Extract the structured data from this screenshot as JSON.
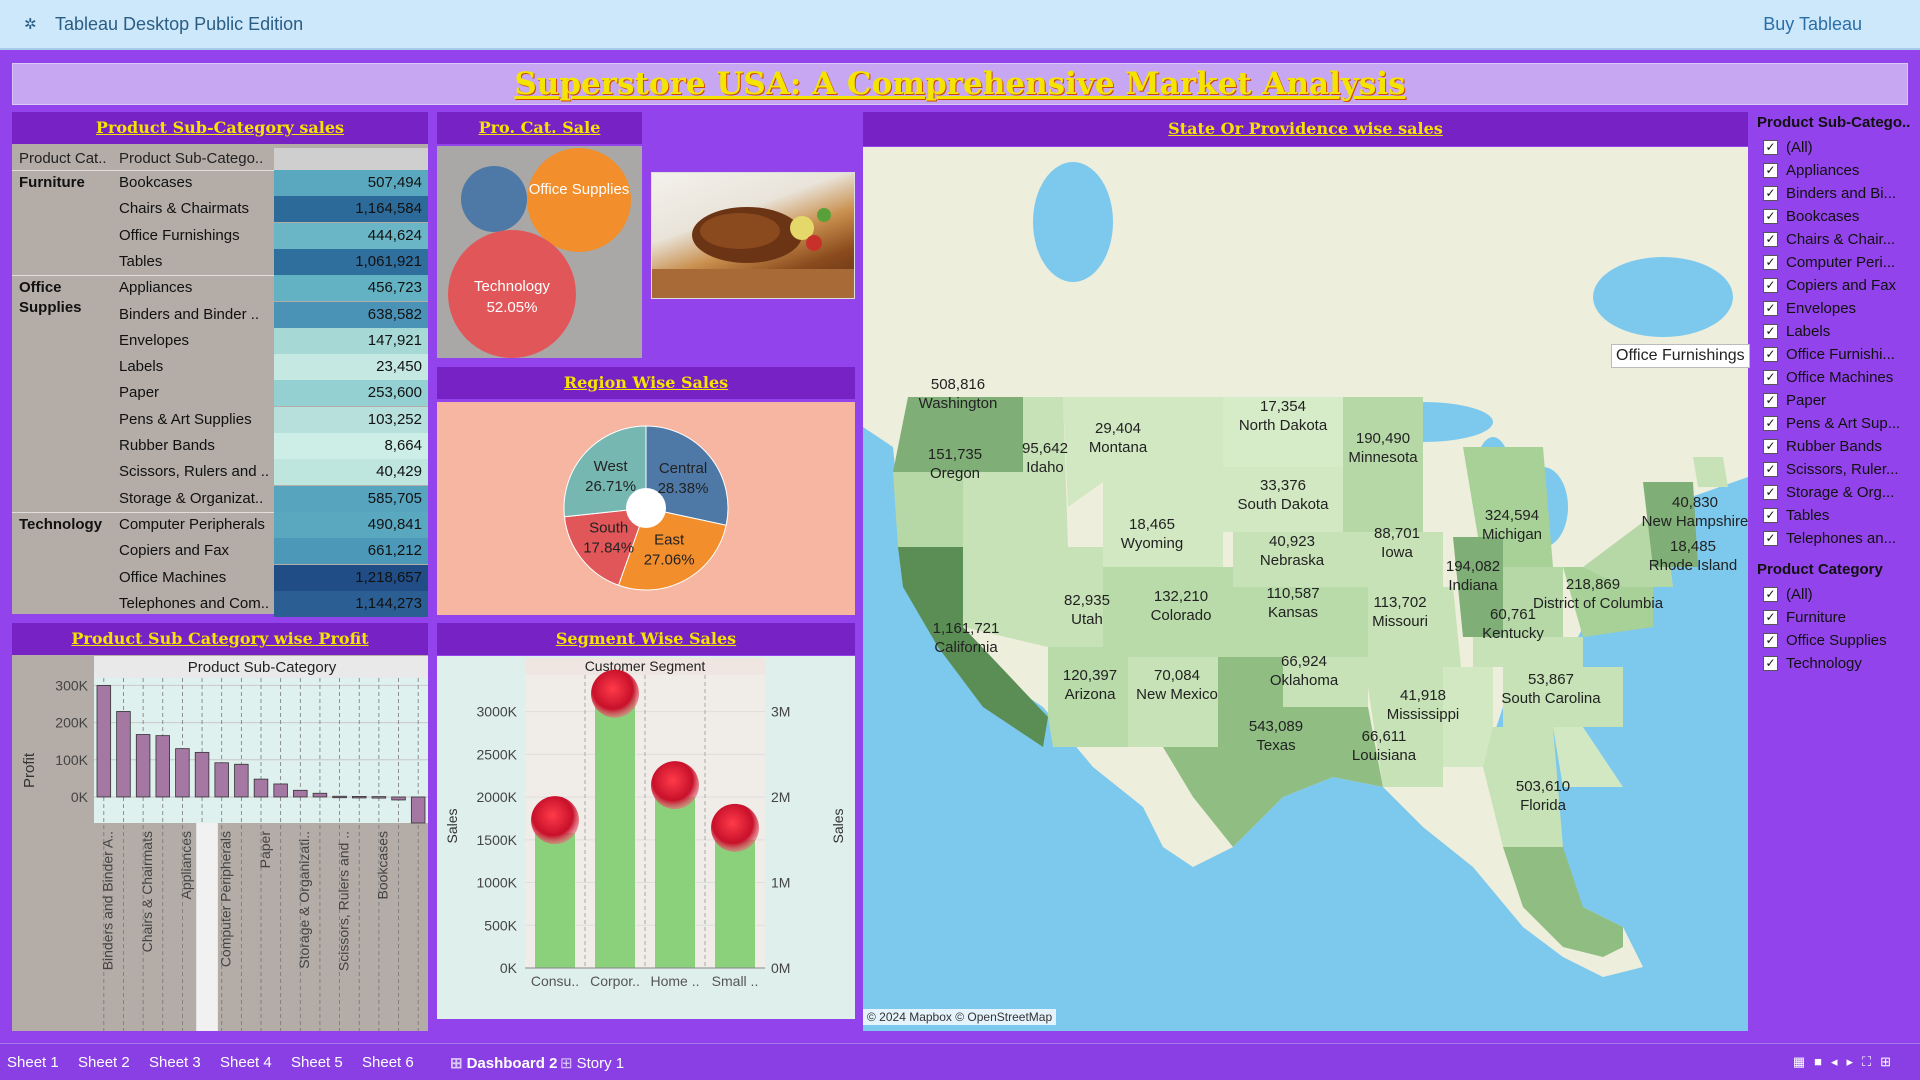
{
  "header": {
    "app_title": "Tableau Desktop Public Edition",
    "buy_label": "Buy Tableau"
  },
  "dashboard_title": "Superstore USA: A Comprehensive Market Analysis",
  "subcat_sales": {
    "title": "Product Sub-Category sales",
    "col1": "Product Cat..",
    "col2": "Product Sub-Catego..",
    "rows": [
      {
        "cat": "Furniture",
        "sub": "Bookcases",
        "val": "507,494"
      },
      {
        "cat": "",
        "sub": "Chairs & Chairmats",
        "val": "1,164,584"
      },
      {
        "cat": "",
        "sub": "Office Furnishings",
        "val": "444,624"
      },
      {
        "cat": "",
        "sub": "Tables",
        "val": "1,061,921"
      },
      {
        "cat": "Office Supplies",
        "sub": "Appliances",
        "val": "456,723"
      },
      {
        "cat": "",
        "sub": "Binders and Binder ..",
        "val": "638,582"
      },
      {
        "cat": "",
        "sub": "Envelopes",
        "val": "147,921"
      },
      {
        "cat": "",
        "sub": "Labels",
        "val": "23,450"
      },
      {
        "cat": "",
        "sub": "Paper",
        "val": "253,600"
      },
      {
        "cat": "",
        "sub": "Pens & Art Supplies",
        "val": "103,252"
      },
      {
        "cat": "",
        "sub": "Rubber Bands",
        "val": "8,664"
      },
      {
        "cat": "",
        "sub": "Scissors, Rulers and ..",
        "val": "40,429"
      },
      {
        "cat": "",
        "sub": "Storage & Organizat..",
        "val": "585,705"
      },
      {
        "cat": "Technology",
        "sub": "Computer Peripherals",
        "val": "490,841"
      },
      {
        "cat": "",
        "sub": "Copiers and Fax",
        "val": "661,212"
      },
      {
        "cat": "",
        "sub": "Office Machines",
        "val": "1,218,657"
      },
      {
        "cat": "",
        "sub": "Telephones and Com..",
        "val": "1,144,273"
      }
    ]
  },
  "cat_sale": {
    "title": "Pro. Cat. Sale",
    "bubbles": [
      {
        "label": "",
        "pct": "",
        "color": "#4e79a7"
      },
      {
        "label": "Office Supplies",
        "pct": "",
        "color": "#f28e2b"
      },
      {
        "label": "Technology",
        "pct": "52.05%",
        "color": "#e15759"
      }
    ]
  },
  "region_sales": {
    "title": "Region Wise Sales",
    "slices": [
      {
        "name": "Central",
        "pct": "28.38%",
        "value": 28.38,
        "color": "#4e79a7"
      },
      {
        "name": "East",
        "pct": "27.06%",
        "value": 27.06,
        "color": "#f28e2b"
      },
      {
        "name": "South",
        "pct": "17.84%",
        "value": 17.84,
        "color": "#e15759"
      },
      {
        "name": "West",
        "pct": "26.71%",
        "value": 26.71,
        "color": "#76b7b2"
      }
    ]
  },
  "state_sales": {
    "title": "State Or Providence wise sales",
    "tooltip": "Office Furnishings",
    "attribution": "© 2024 Mapbox © OpenStreetMap",
    "states": [
      {
        "name": "Washington",
        "val": "508,816"
      },
      {
        "name": "Oregon",
        "val": "151,735"
      },
      {
        "name": "California",
        "val": "1,161,721"
      },
      {
        "name": "Idaho",
        "val": "95,642"
      },
      {
        "name": "Montana",
        "val": "29,404"
      },
      {
        "name": "Wyoming",
        "val": "18,465"
      },
      {
        "name": "Utah",
        "val": "82,935"
      },
      {
        "name": "Arizona",
        "val": "120,397"
      },
      {
        "name": "Colorado",
        "val": "132,210"
      },
      {
        "name": "New Mexico",
        "val": "70,084"
      },
      {
        "name": "North Dakota",
        "val": "17,354"
      },
      {
        "name": "South Dakota",
        "val": "33,376"
      },
      {
        "name": "Nebraska",
        "val": "40,923"
      },
      {
        "name": "Kansas",
        "val": "110,587"
      },
      {
        "name": "Oklahoma",
        "val": "66,924"
      },
      {
        "name": "Texas",
        "val": "543,089"
      },
      {
        "name": "Minnesota",
        "val": "190,490"
      },
      {
        "name": "Iowa",
        "val": "88,701"
      },
      {
        "name": "Missouri",
        "val": "113,702"
      },
      {
        "name": "Louisiana",
        "val": "66,611"
      },
      {
        "name": "Mississippi",
        "val": "41,918"
      },
      {
        "name": "Michigan",
        "val": "324,594"
      },
      {
        "name": "Indiana",
        "val": "194,082"
      },
      {
        "name": "Kentucky",
        "val": "60,761"
      },
      {
        "name": "District of Columbia",
        "val": "218,869"
      },
      {
        "name": "South Carolina",
        "val": "53,867"
      },
      {
        "name": "Florida",
        "val": "503,610"
      },
      {
        "name": "New Hampshire",
        "val": "40,830"
      },
      {
        "name": "Rhode Island",
        "val": "18,485"
      }
    ]
  },
  "filters": {
    "subcat_title": "Product Sub-Catego..",
    "subcat_items": [
      "(All)",
      "Appliances",
      "Binders and Bi...",
      "Bookcases",
      "Chairs & Chair...",
      "Computer Peri...",
      "Copiers and Fax",
      "Envelopes",
      "Labels",
      "Office Furnishi...",
      "Office Machines",
      "Paper",
      "Pens & Art Sup...",
      "Rubber Bands",
      "Scissors, Ruler...",
      "Storage & Org...",
      "Tables",
      "Telephones an..."
    ],
    "cat_title": "Product Category",
    "cat_items": [
      "(All)",
      "Furniture",
      "Office Supplies",
      "Technology"
    ]
  },
  "subcat_profit": {
    "title": "Product Sub Category wise Profit",
    "header": "Product Sub-Category",
    "ylabel": "Profit",
    "yticks": [
      "300K",
      "200K",
      "100K",
      "0K"
    ],
    "xlabels": [
      "Binders and Binder A..",
      "Chairs & Chairmats",
      "Appliances",
      "Computer Peripherals",
      "Paper",
      "Storage & Organizati..",
      "Scissors, Rulers and ..",
      "Bookcases"
    ]
  },
  "chart_data": {
    "type": "bar",
    "xlabel": "Product Sub-Category",
    "ylabel": "Profit",
    "ylim": [
      -70000,
      320000
    ],
    "values": [
      300000,
      230000,
      168000,
      165000,
      130000,
      120000,
      92000,
      88000,
      48000,
      35000,
      18000,
      10000,
      2000,
      1500,
      1000,
      -8000,
      -70000
    ]
  },
  "segment_sales": {
    "title": "Segment Wise Sales",
    "header": "Customer Segment",
    "ylabel_left": "Sales",
    "ylabel_right": "Sales",
    "yticks_left": [
      "3000K",
      "2500K",
      "2000K",
      "1500K",
      "1000K",
      "500K",
      "0K"
    ],
    "yticks_right": [
      "3M",
      "2M",
      "1M",
      "0M"
    ],
    "categories": [
      "Consu..",
      "Corpor..",
      "Home ..",
      "Small .."
    ],
    "bar_values": [
      1580000,
      3260000,
      2000000,
      1500000
    ],
    "dot_values": [
      1730000,
      3210000,
      2140000,
      1640000
    ]
  },
  "tabs": [
    "Sheet 1",
    "Sheet 2",
    "Sheet 3",
    "Sheet 4",
    "Sheet 5",
    "Sheet 6",
    "Dashboard 2",
    "Story 1"
  ]
}
